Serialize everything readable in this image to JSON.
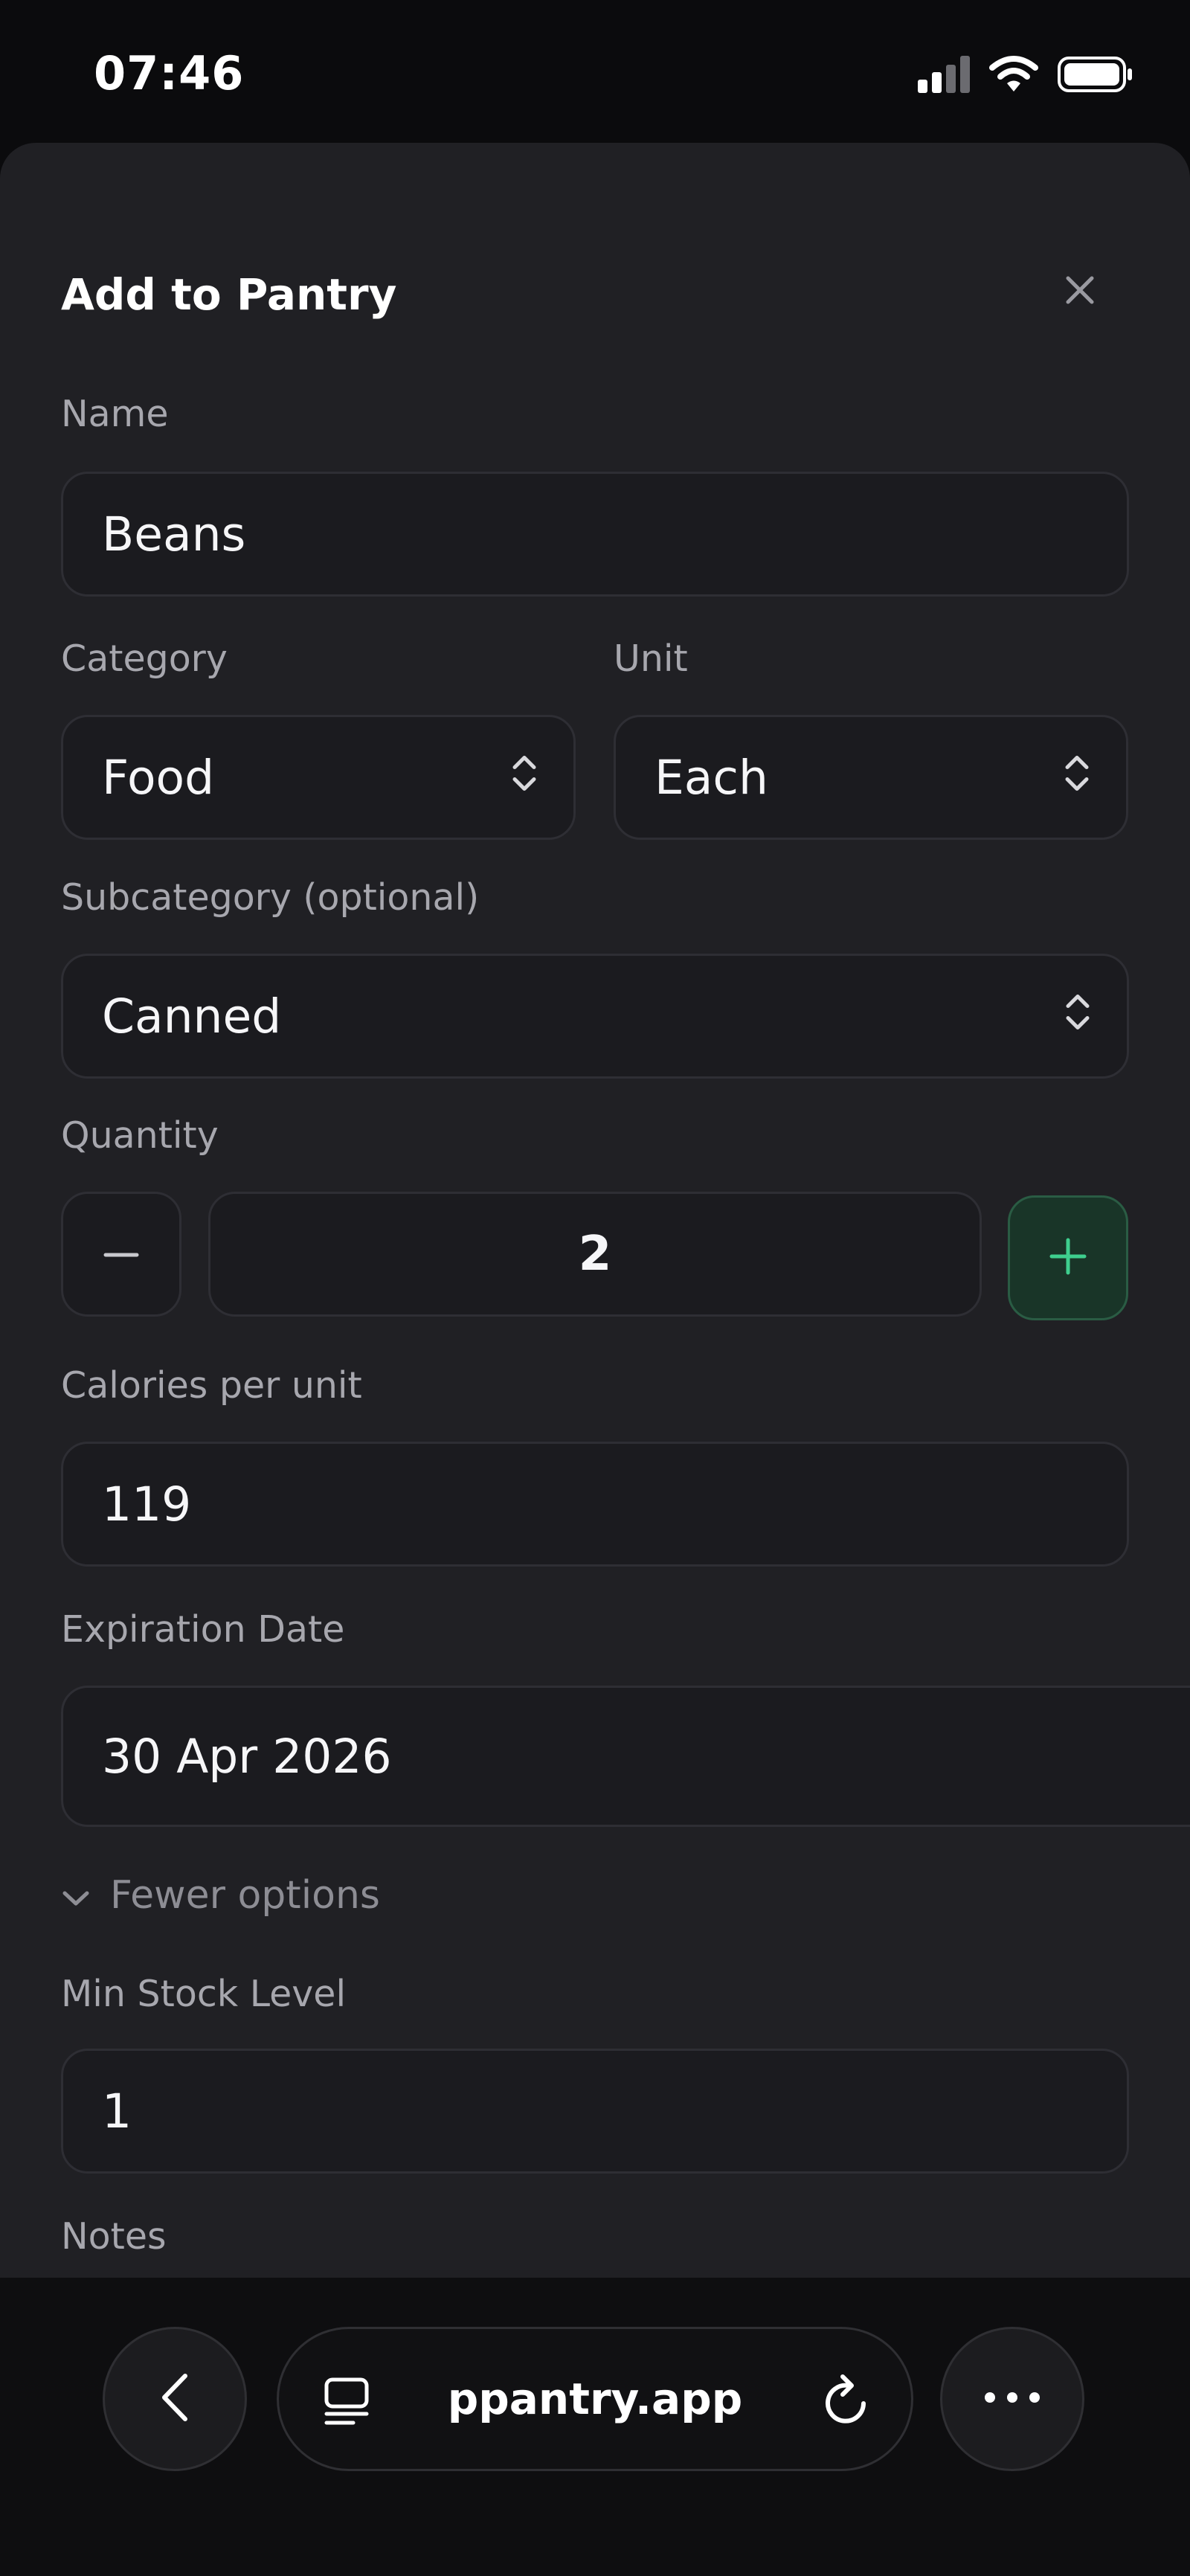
{
  "status_bar": {
    "time": "07:46",
    "icons": [
      "signal-icon",
      "wifi-icon",
      "battery-icon"
    ]
  },
  "sheet": {
    "title": "Add to Pantry",
    "close_icon": "close-icon",
    "fields": {
      "name": {
        "label": "Name",
        "value": "Beans"
      },
      "category": {
        "label": "Category",
        "value": "Food"
      },
      "unit": {
        "label": "Unit",
        "value": "Each"
      },
      "subcategory": {
        "label": "Subcategory (optional)",
        "value": "Canned"
      },
      "quantity": {
        "label": "Quantity",
        "value": "2",
        "decrement_icon": "minus-icon",
        "increment_icon": "plus-icon"
      },
      "calories": {
        "label": "Calories per unit",
        "value": "119"
      },
      "expiration": {
        "label": "Expiration Date",
        "value": "30 Apr 2026"
      },
      "min_stock": {
        "label": "Min Stock Level",
        "value": "1"
      },
      "notes": {
        "label": "Notes"
      }
    },
    "fewer_options": "Fewer options"
  },
  "browser_bar": {
    "url": "ppantry.app",
    "back_icon": "chevron-left-icon",
    "tabs_icon": "tabs-icon",
    "reload_icon": "reload-icon",
    "more_icon": "more-icon"
  },
  "colors": {
    "sheet_bg": "#202024",
    "field_bg": "#1b1b1f",
    "accent": "#3ecf8e",
    "accent_bg": "#193528"
  }
}
